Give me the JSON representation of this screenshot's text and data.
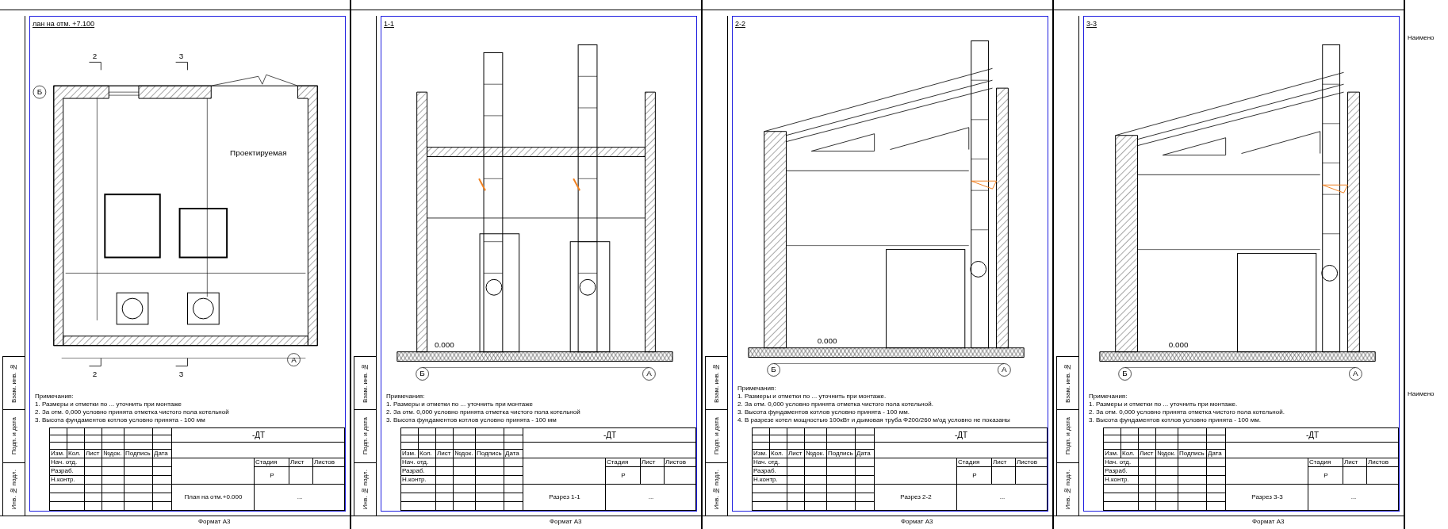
{
  "sheets": [
    {
      "strip_labels": [
        "Взам. инв. №",
        "Подп. и дата",
        "Инв. № подл."
      ],
      "view_label": "лан на отм. +7.100",
      "drawing": {
        "kind": "plan",
        "labels": [
          {
            "text": "2"
          },
          {
            "text": "3"
          },
          {
            "text": "Б"
          },
          {
            "text": "А"
          },
          {
            "text": "2"
          },
          {
            "text": "3"
          },
          {
            "text": "Проектируемая"
          }
        ]
      },
      "notes_title": "Примечания:",
      "notes": [
        "1. Размеры и отметки по ... уточнить при монтаже",
        "2. За отм. 0,000 условно принята отметка чистого пола котельной",
        "3. Высота фундаментов котлов условно принята - 100 мм"
      ],
      "title_block": {
        "code": "-ДТ",
        "head": [
          "Изм.",
          "Кол.",
          "Лист",
          "№док.",
          "Подпись",
          "Дата"
        ],
        "roles": [
          "Нач. отд.",
          "Разраб.",
          "Н.контр."
        ],
        "drawing_title": "План на отм.+0.000",
        "stage_heads": [
          "Стадия",
          "Лист",
          "Листов"
        ],
        "stage": "Р",
        "org": "..."
      },
      "format": "Формат А3"
    },
    {
      "strip_labels": [
        "Взам. инв. №",
        "Подп. и дата",
        "Инв. № подл."
      ],
      "view_label": "1-1",
      "drawing": {
        "kind": "section-double",
        "labels": [
          {
            "text": "Б"
          },
          {
            "text": "А"
          },
          {
            "text": "0.000"
          }
        ]
      },
      "notes_title": "Примечания:",
      "notes": [
        "1. Размеры и отметки по ... уточнить при монтаже",
        "2. За отм. 0,000 условно принята отметка чистого пола котельной",
        "3. Высота фундаментов котлов условно принята - 100 мм"
      ],
      "title_block": {
        "code": "-ДТ",
        "head": [
          "Изм.",
          "Кол.",
          "Лист",
          "№док.",
          "Подпись",
          "Дата"
        ],
        "roles": [
          "Нач. отд.",
          "Разраб.",
          "Н.контр."
        ],
        "drawing_title": "Разрез 1-1",
        "stage_heads": [
          "Стадия",
          "Лист",
          "Листов"
        ],
        "stage": "Р",
        "org": "..."
      },
      "format": "Формат А3"
    },
    {
      "strip_labels": [
        "Взам. инв. №",
        "Подп. и дата",
        "Инв. № подл."
      ],
      "view_label": "2-2",
      "drawing": {
        "kind": "section-single",
        "labels": [
          {
            "text": "Б"
          },
          {
            "text": "А"
          },
          {
            "text": "0.000"
          }
        ]
      },
      "notes_title": "Примечания:",
      "notes": [
        "1. Размеры и отметки по ... уточнить при монтаже.",
        "2. За отм. 0,000 условно принята отметка чистого пола котельной.",
        "3. Высота фундаментов котлов условно принята - 100 мм.",
        "4. В разрезе котел мощностью 100кВт и дымовая труба Ф200/260 м/од условно не показаны"
      ],
      "title_block": {
        "code": "-ДТ",
        "head": [
          "Изм.",
          "Кол.",
          "Лист",
          "№док.",
          "Подпись",
          "Дата"
        ],
        "roles": [
          "Нач. отд.",
          "Разраб.",
          "Н.контр."
        ],
        "drawing_title": "Разрез 2-2",
        "stage_heads": [
          "Стадия",
          "Лист",
          "Листов"
        ],
        "stage": "Р",
        "org": "..."
      },
      "format": "Формат А3"
    },
    {
      "strip_labels": [
        "Взам. инв. №",
        "Подп. и дата",
        "Инв. № подл."
      ],
      "view_label": "3-3",
      "drawing": {
        "kind": "section-single",
        "labels": [
          {
            "text": "Б"
          },
          {
            "text": "А"
          },
          {
            "text": "0.000"
          }
        ]
      },
      "notes_title": "Примечания:",
      "notes": [
        "1. Размеры и отметки по ... уточнить при монтаже.",
        "2. За отм. 0,000 условно принята отметка чистого пола котельной.",
        "3. Высота фундаментов котлов условно принята - 100 мм."
      ],
      "title_block": {
        "code": "-ДТ",
        "head": [
          "Изм.",
          "Кол.",
          "Лист",
          "№док.",
          "Подпись",
          "Дата"
        ],
        "roles": [
          "Нач. отд.",
          "Разраб.",
          "Н.контр."
        ],
        "drawing_title": "Разрез 3-3",
        "stage_heads": [
          "Стадия",
          "Лист",
          "Листов"
        ],
        "stage": "Р",
        "org": "..."
      },
      "format": "Формат А3"
    }
  ],
  "edge_labels": [
    "Наимено",
    "Наимено"
  ]
}
